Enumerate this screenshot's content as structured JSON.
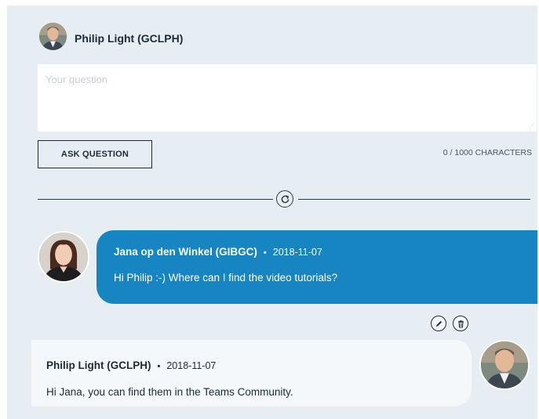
{
  "current_user": {
    "name": "Philip Light (GCLPH)",
    "avatar": "avatar-philip"
  },
  "question_form": {
    "placeholder": "Your question",
    "value": "",
    "ask_button_label": "ASK QUESTION",
    "char_counter": "0 / 1000 CHARACTERS"
  },
  "refresh": {
    "icon": "refresh-icon"
  },
  "messages": [
    {
      "author": "Jana op den Winkel (GIBGC)",
      "separator": "•",
      "date": "2018-11-07",
      "text": "Hi Philip :-) Where can I find the video tutorials?",
      "bubble_color": "#1685c2",
      "actions": [
        "edit-icon",
        "delete-icon"
      ]
    },
    {
      "author": "Philip Light (GCLPH)",
      "separator": "•",
      "date": "2018-11-07",
      "text": "Hi Jana, you can find them in the Teams Community.",
      "bubble_color": "#f5f8fb"
    }
  ],
  "colors": {
    "panel_bg": "#e7eef3",
    "accent": "#1685c2",
    "text_dark": "#1d2a36"
  }
}
